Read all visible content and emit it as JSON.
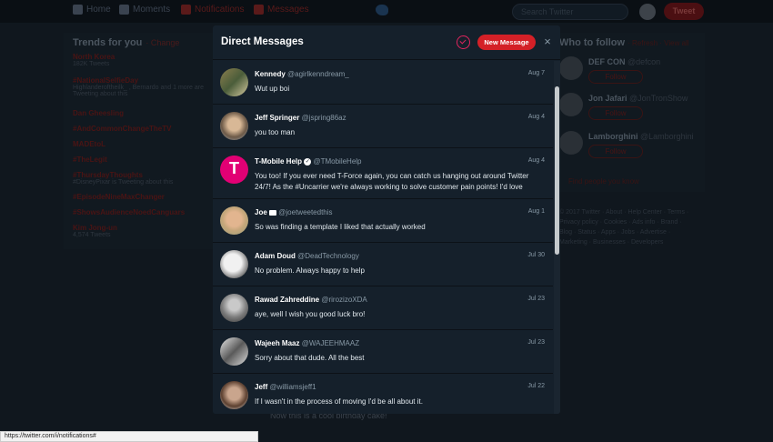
{
  "topbar": {
    "nav": [
      "Home",
      "Moments",
      "Notifications",
      "Messages"
    ],
    "search_placeholder": "Search Twitter",
    "tweet_label": "Tweet"
  },
  "trends": {
    "title": "Trends for you",
    "change": "· Change",
    "items": [
      {
        "t": "North Korea",
        "s": "182K Tweets"
      },
      {
        "t": "#NationalSelfieDay",
        "s": "Highlanderoftheilk_ , Bernardo and 1 more are Tweeting about this"
      },
      {
        "t": "Dan Gheesling",
        "s": ""
      },
      {
        "t": "#AndCommonChangeTheTV",
        "s": ""
      },
      {
        "t": "MADEtoL",
        "s": ""
      },
      {
        "t": "#TheLegit",
        "s": ""
      },
      {
        "t": "#ThursdayThoughts",
        "s": "#DisneyPixar is Tweeting about this"
      },
      {
        "t": "#EpisodeNineMaxChanger",
        "s": ""
      },
      {
        "t": "#ShowsAudienceNoedCanguars",
        "s": ""
      },
      {
        "t": "Kim Jong-un",
        "s": "4,574 Tweets"
      }
    ]
  },
  "who_to_follow": {
    "title": "Who to follow",
    "links": "· Refresh · View all",
    "users": [
      {
        "name": "DEF CON",
        "handle": "@defcon",
        "follow": "Follow"
      },
      {
        "name": "Jon Jafari",
        "handle": "@JonTronShow",
        "follow": "Follow"
      },
      {
        "name": "Lamborghini",
        "handle": "@Lamborghini",
        "follow": "Follow"
      }
    ],
    "find_people": "Find people you know",
    "footer": "© 2017 Twitter · About · Help Center · Terms · Privacy policy · Cookies · Ads info · Brand · Blog · Status · Apps · Jobs · Advertise · Marketing · Businesses · Developers"
  },
  "background_tweet": "Now this is a cool birthday cake!",
  "dm": {
    "title": "Direct Messages",
    "new_message": "New Message",
    "close": "×",
    "conversations": [
      {
        "name": "Kennedy",
        "handle": "@agirlkenndream_",
        "date": "Aug 7",
        "preview": "Wut up boi",
        "badge": ""
      },
      {
        "name": "Jeff Springer",
        "handle": "@jspring86az",
        "date": "Aug 4",
        "preview": "you too man",
        "badge": ""
      },
      {
        "name": "T-Mobile Help",
        "handle": "@TMobileHelp",
        "date": "Aug 4",
        "preview": "You too! If you ever need T-Force again, you can catch us hanging out around Twitter 24/7! As the #Uncarrier we're always working to solve customer pain points! I'd love",
        "badge": "verified"
      },
      {
        "name": "Joe",
        "handle": "@joetweetedthis",
        "date": "Aug 1",
        "preview": "So was finding a template I liked that actually worked",
        "badge": "camera"
      },
      {
        "name": "Adam Doud",
        "handle": "@DeadTechnology",
        "date": "Jul 30",
        "preview": "No problem. Always happy to help",
        "badge": ""
      },
      {
        "name": "Rawad Zahreddine",
        "handle": "@rirozizoXDA",
        "date": "Jul 23",
        "preview": "aye, well I wish you good luck bro!",
        "badge": ""
      },
      {
        "name": "Wajeeh Maaz",
        "handle": "@WAJEEHMAAZ",
        "date": "Jul 23",
        "preview": "Sorry about that dude. All the best",
        "badge": ""
      },
      {
        "name": "Jeff",
        "handle": "@williamsjeff1",
        "date": "Jul 22",
        "preview": "If I wasn't in the process of moving I'd be all about it.",
        "badge": ""
      }
    ]
  },
  "status_url": "https://twitter.com/i/notifications#",
  "colors": {
    "accent": "#d42027",
    "bg": "#10171e",
    "modal": "#15202b"
  }
}
